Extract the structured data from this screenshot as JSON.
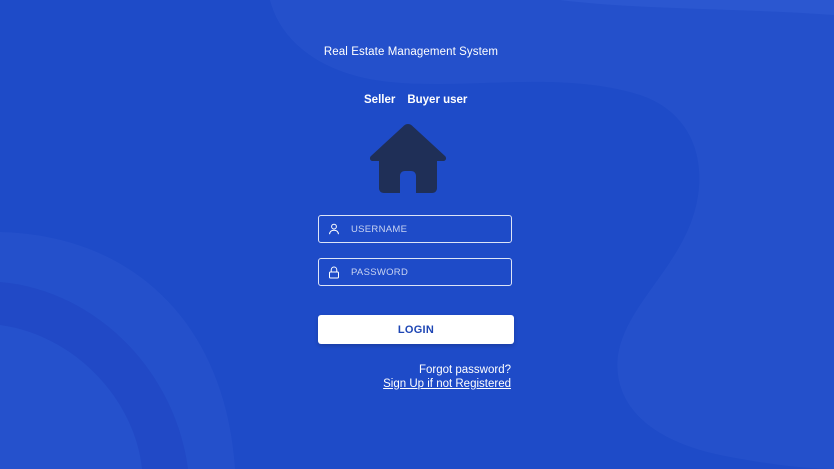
{
  "app": {
    "title": "Real Estate Management System"
  },
  "tabs": [
    {
      "label": "Seller"
    },
    {
      "label": "Buyer user"
    }
  ],
  "logo": {
    "icon": "house-icon",
    "color": "#1f2f57"
  },
  "form": {
    "username": {
      "icon": "user-icon",
      "placeholder": "USERNAME",
      "value": ""
    },
    "password": {
      "icon": "lock-icon",
      "placeholder": "PASSWORD",
      "value": ""
    },
    "login_label": "LOGIN"
  },
  "links": {
    "forgot_password": "Forgot password?",
    "sign_up": "Sign Up if not Registered"
  },
  "colors": {
    "background": "#1e4bc8",
    "accent_shapes": "#2a55cf",
    "button_bg": "#ffffff",
    "button_text": "#1e46b4",
    "text": "#ffffff"
  }
}
